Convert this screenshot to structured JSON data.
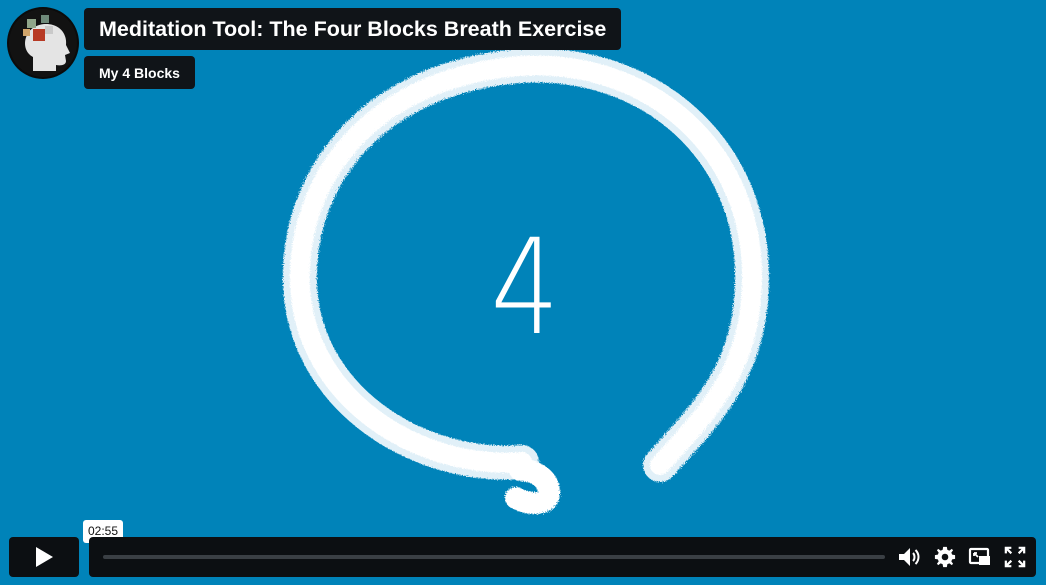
{
  "video": {
    "title": "Meditation Tool: The Four Blocks Breath Exercise",
    "channel": "My 4 Blocks",
    "frame_number": "4",
    "background_color": "#0083b9"
  },
  "controls": {
    "time_tooltip": "02:55",
    "progress_fraction": 0.0,
    "play_icon": "play-icon",
    "volume_icon": "volume-icon",
    "settings_icon": "gear-icon",
    "pip_icon": "picture-in-picture-icon",
    "fullscreen_icon": "fullscreen-icon"
  }
}
